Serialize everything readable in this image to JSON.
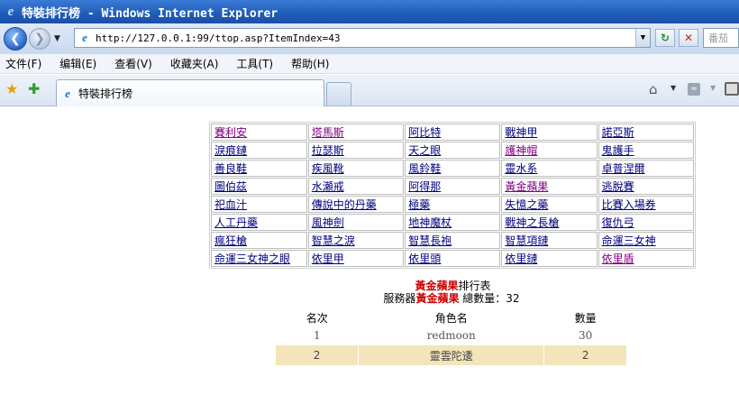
{
  "window": {
    "title": "特裝排行榜 - Windows Internet Explorer"
  },
  "address": {
    "url": "http://127.0.0.1:99/ttop.asp?ItemIndex=43",
    "search_placeholder": "番茄"
  },
  "menu": [
    "文件(F)",
    "编辑(E)",
    "查看(V)",
    "收藏夹(A)",
    "工具(T)",
    "帮助(H)"
  ],
  "tab": {
    "label": "特裝排行榜"
  },
  "items": [
    [
      {
        "label": "賽利安",
        "visited": true
      },
      {
        "label": "塔馬斯",
        "visited": true
      },
      {
        "label": "阿比特",
        "visited": false
      },
      {
        "label": "戰神甲",
        "visited": false
      },
      {
        "label": "諾亞斯",
        "visited": false
      }
    ],
    [
      {
        "label": "淚痕鏈",
        "visited": false
      },
      {
        "label": "拉瑟斯",
        "visited": false
      },
      {
        "label": "天之眼",
        "visited": false
      },
      {
        "label": "護神帽",
        "visited": true
      },
      {
        "label": "鬼護手",
        "visited": false
      }
    ],
    [
      {
        "label": "善良鞋",
        "visited": false
      },
      {
        "label": "疾風靴",
        "visited": false
      },
      {
        "label": "風鈴鞋",
        "visited": false
      },
      {
        "label": "靈水系",
        "visited": false
      },
      {
        "label": "卓普涅爾",
        "visited": false
      }
    ],
    [
      {
        "label": "圖伯茲",
        "visited": false
      },
      {
        "label": "水瀬戒",
        "visited": false
      },
      {
        "label": "阿得那",
        "visited": false
      },
      {
        "label": "黃金蘋果",
        "visited": true
      },
      {
        "label": "逃脫賽",
        "visited": false
      }
    ],
    [
      {
        "label": "祀血汁",
        "visited": false
      },
      {
        "label": "傳說中的丹藥",
        "visited": false
      },
      {
        "label": "極藥",
        "visited": false
      },
      {
        "label": "失憶之藥",
        "visited": false
      },
      {
        "label": "比賽入場券",
        "visited": false
      }
    ],
    [
      {
        "label": "人工丹藥",
        "visited": false
      },
      {
        "label": "風神劍",
        "visited": false
      },
      {
        "label": "地神魔杖",
        "visited": false
      },
      {
        "label": "戰神之長槍",
        "visited": false
      },
      {
        "label": "復仇弓",
        "visited": false
      }
    ],
    [
      {
        "label": "瘋狂槍",
        "visited": false
      },
      {
        "label": "智慧之淚",
        "visited": false
      },
      {
        "label": "智慧長袍",
        "visited": false
      },
      {
        "label": "智慧項鏈",
        "visited": false
      },
      {
        "label": "命運三女神",
        "visited": false
      }
    ],
    [
      {
        "label": "命運三女神之眼",
        "visited": false
      },
      {
        "label": "依里甲",
        "visited": false
      },
      {
        "label": "依里頭",
        "visited": false
      },
      {
        "label": "依里鏈",
        "visited": false
      },
      {
        "label": "依里盾",
        "visited": true
      }
    ]
  ],
  "ranking": {
    "item_name": "黃金蘋果",
    "title_suffix": "排行表",
    "server_prefix": "服務器",
    "total_label": " 總數量：",
    "total": "32",
    "headers": [
      "名次",
      "角色名",
      "數量"
    ],
    "rows": [
      [
        "1",
        "redmoon",
        "30"
      ],
      [
        "2",
        "靈雲陀逶",
        "2"
      ]
    ]
  }
}
